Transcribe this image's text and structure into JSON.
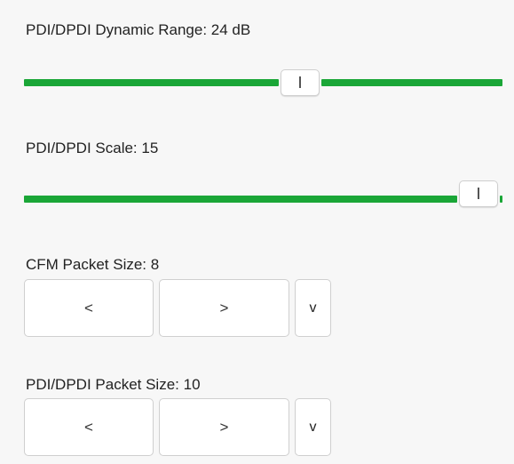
{
  "dynamic_range": {
    "label": "PDI/DPDI Dynamic Range: 24 dB",
    "position": 0.584
  },
  "scale": {
    "label": "PDI/DPDI Scale: 15",
    "position": 0.99
  },
  "cfm_packet": {
    "label": "CFM Packet Size: 8",
    "prev_label": "<",
    "next_label": ">",
    "dropdown_label": "v"
  },
  "pdi_packet": {
    "label": "PDI/DPDI Packet Size: 10",
    "prev_label": "<",
    "next_label": ">",
    "dropdown_label": "v"
  },
  "colors": {
    "track": "#1aa637",
    "background": "#f7f7f7"
  }
}
